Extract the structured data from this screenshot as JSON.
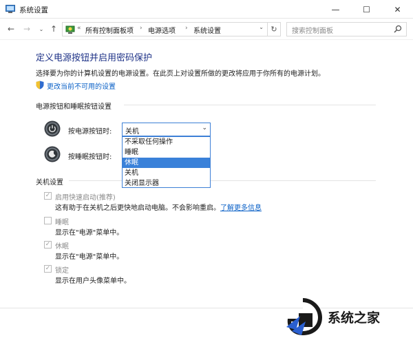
{
  "window": {
    "title": "系统设置",
    "minimize": "—",
    "maximize": "☐",
    "close": "✕"
  },
  "nav": {
    "back": "←",
    "forward": "→",
    "dropdown": "⌄",
    "up": "↑",
    "breadcrumb_prefix": "«",
    "breadcrumb": [
      "所有控制面板项",
      "电源选项",
      "系统设置"
    ],
    "breadcrumb_sep": "›",
    "address_dropdown": "⌄",
    "refresh": "↻",
    "search_placeholder": "搜索控制面板"
  },
  "page": {
    "heading": "定义电源按钮并启用密码保护",
    "description": "选择要为你的计算机设置的电源设置。在此页上对设置所做的更改将应用于你所有的电源计划。",
    "unlock_link": "更改当前不可用的设置"
  },
  "power_section": {
    "title": "电源按钮和睡眠按钮设置",
    "power_button_label": "按电源按钮时:",
    "sleep_button_label": "按睡眠按钮时:",
    "power_button_value": "关机",
    "combo_arrow": "⌄",
    "dropdown_options": [
      "不采取任何操作",
      "睡眠",
      "休眠",
      "关机",
      "关闭显示器"
    ],
    "dropdown_selected_index": 2
  },
  "shutdown_section": {
    "title": "关机设置",
    "options": [
      {
        "label": "启用快速启动(推荐)",
        "desc": "这有助于在关机之后更快地启动电脑。不会影响重启。",
        "link": "了解更多信息",
        "checked": true
      },
      {
        "label": "睡眠",
        "desc": "显示在\"电源\"菜单中。",
        "checked": false
      },
      {
        "label": "休眠",
        "desc": "显示在\"电源\"菜单中。",
        "checked": true
      },
      {
        "label": "锁定",
        "desc": "显示在用户头像菜单中。",
        "checked": true
      }
    ],
    "check_mark": "✓"
  },
  "watermark": {
    "text": "系统之家"
  },
  "colors": {
    "heading": "#1e3287",
    "link": "#0b61c7",
    "selection": "#3a81d9",
    "combo_border": "#3c7fd6"
  }
}
